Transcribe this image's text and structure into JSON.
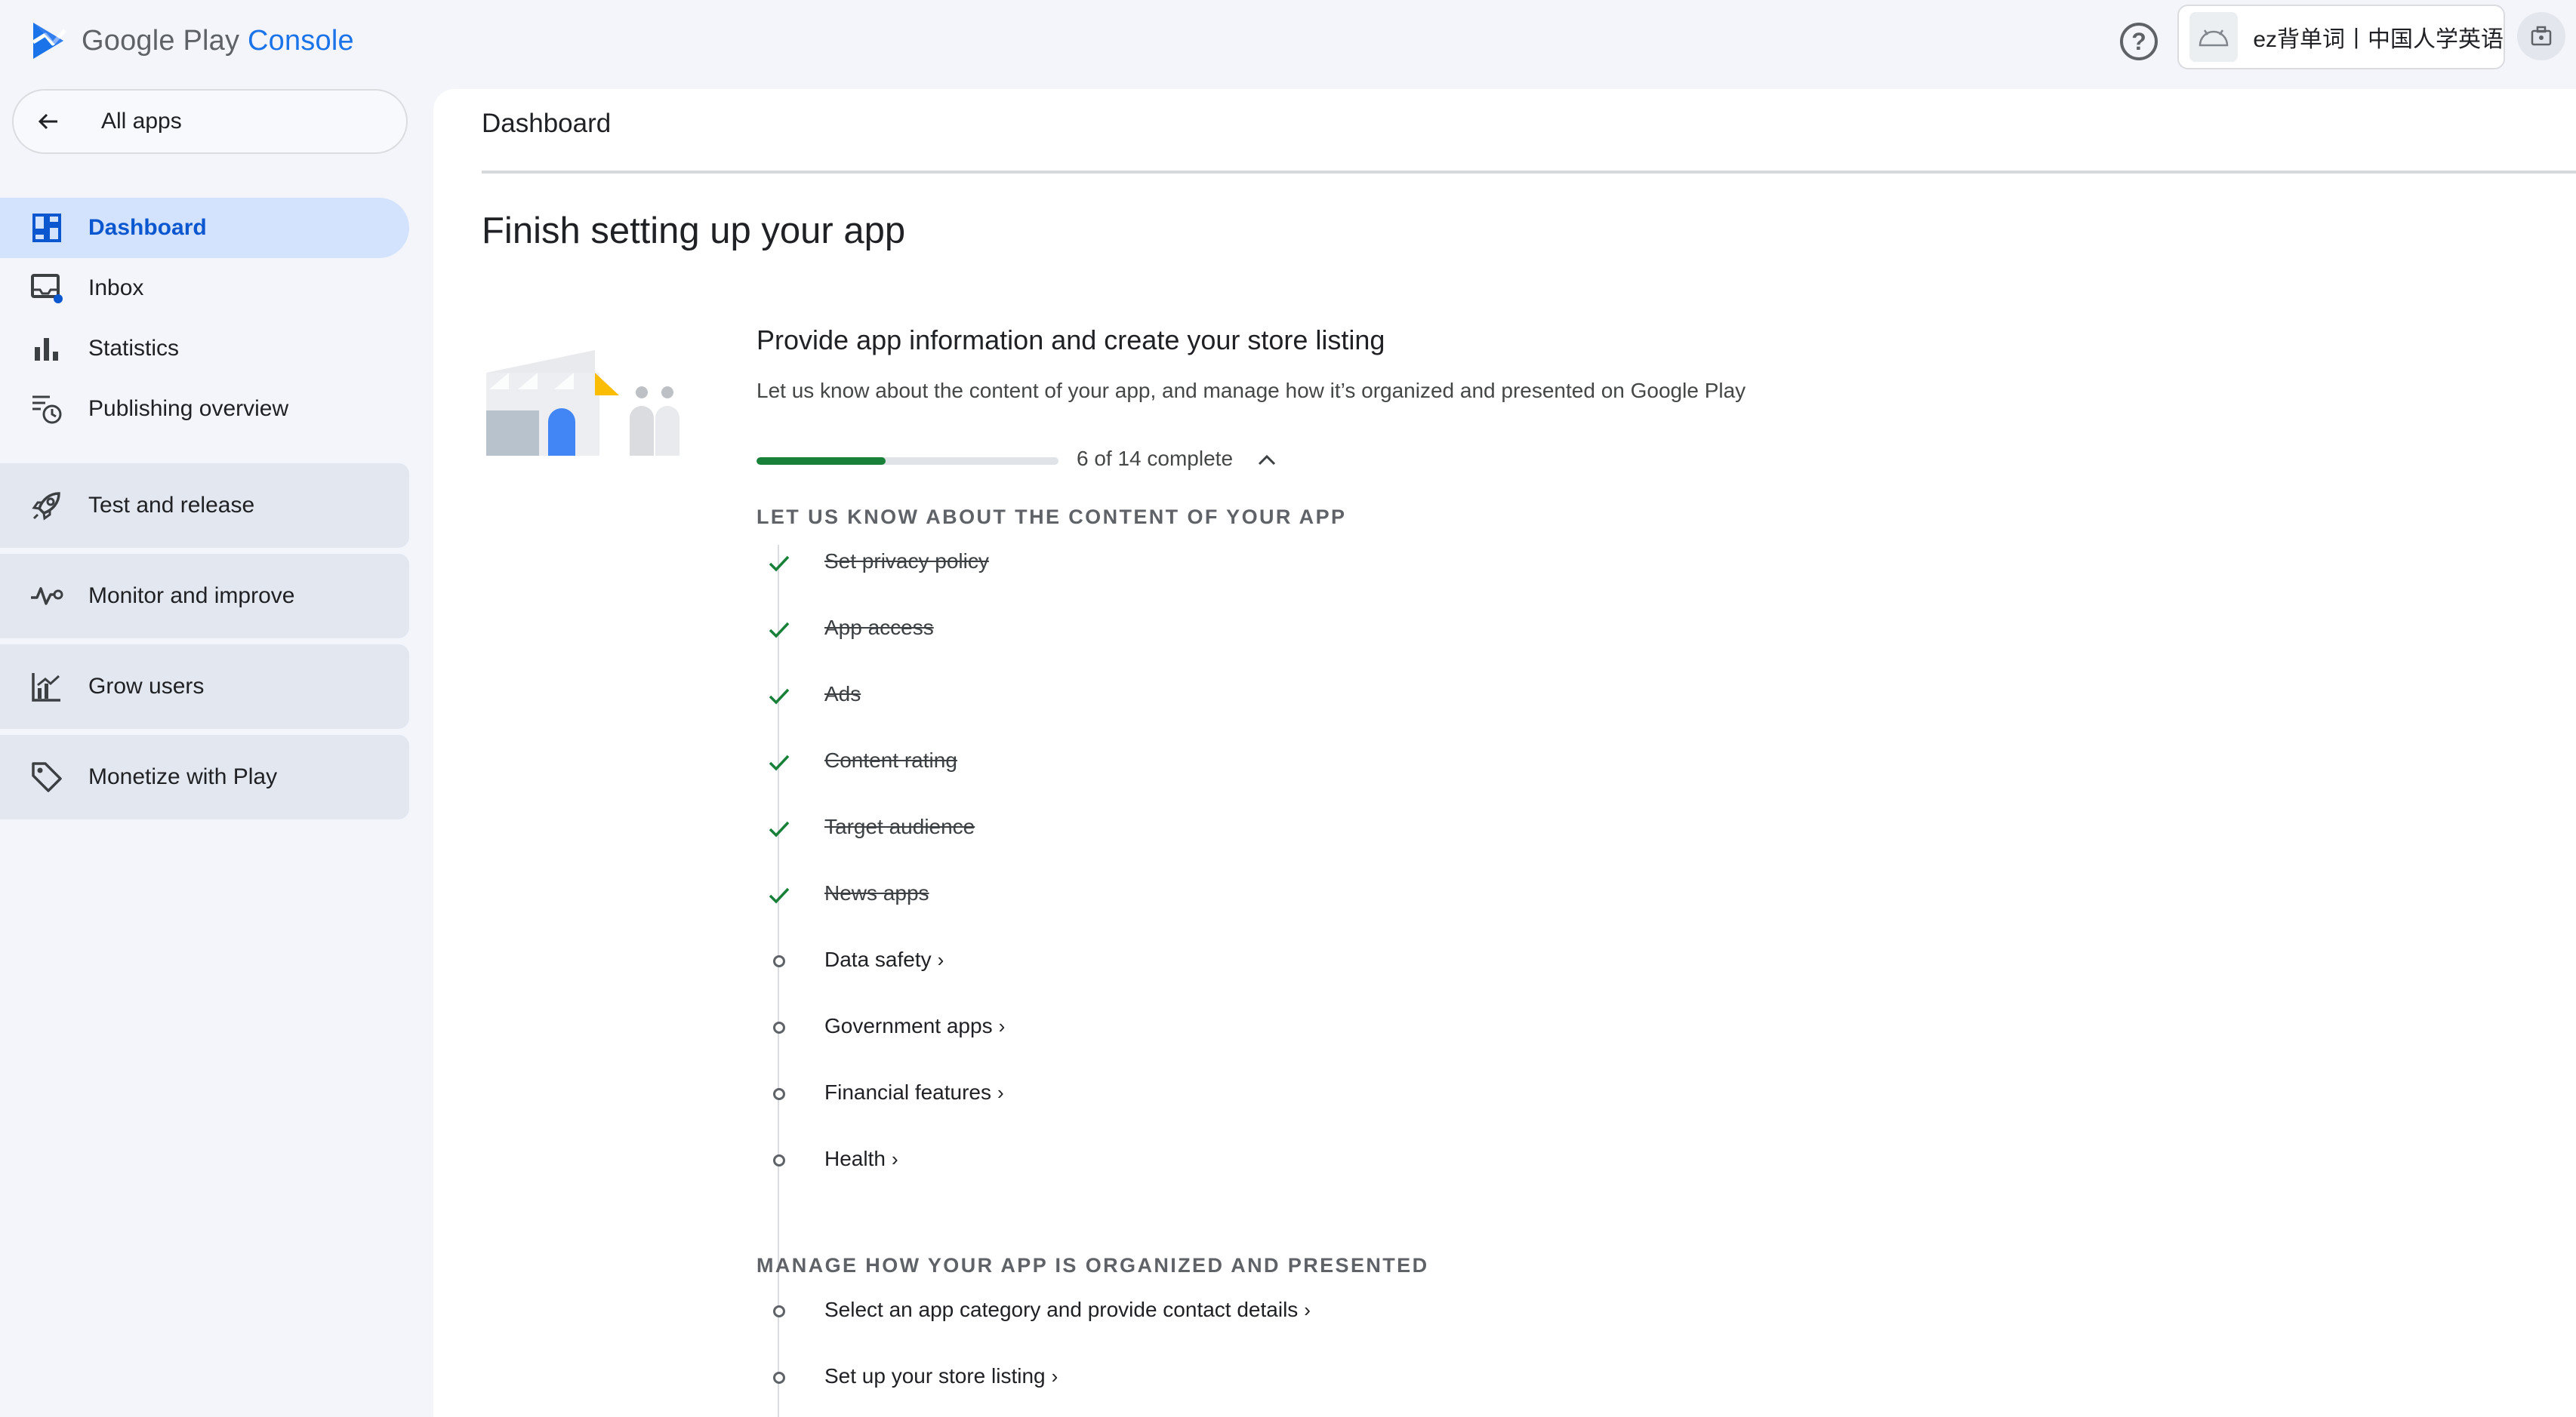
{
  "app": {
    "brand_google_play": "Google Play",
    "brand_console": "Console",
    "help_icon_label": "?",
    "app_name": "ez背单词丨中国人学英语"
  },
  "sidebar": {
    "all_apps": "All apps",
    "items": [
      {
        "label": "Dashboard",
        "icon": "dashboard-icon",
        "active": true
      },
      {
        "label": "Inbox",
        "icon": "inbox-icon",
        "active": false
      },
      {
        "label": "Statistics",
        "icon": "bar-chart-icon",
        "active": false
      },
      {
        "label": "Publishing overview",
        "icon": "publishing-clock-icon",
        "active": false
      }
    ],
    "groups": [
      {
        "label": "Test and release",
        "icon": "rocket-icon"
      },
      {
        "label": "Monitor and improve",
        "icon": "vitals-icon"
      },
      {
        "label": "Grow users",
        "icon": "growth-icon"
      },
      {
        "label": "Monetize with Play",
        "icon": "tag-icon"
      }
    ]
  },
  "main": {
    "page_title": "Dashboard",
    "heading": "Finish setting up your app",
    "section": {
      "title": "Provide app information and create your store listing",
      "description": "Let us know about the content of your app, and manage how it’s organized and presented on Google Play",
      "progress_label": "6 of 14 complete",
      "progress_fraction": 0.4286,
      "group1_label": "LET US KNOW ABOUT THE CONTENT OF YOUR APP",
      "group1_tasks": [
        {
          "label": "Set privacy policy",
          "done": true
        },
        {
          "label": "App access",
          "done": true
        },
        {
          "label": "Ads",
          "done": true
        },
        {
          "label": "Content rating",
          "done": true
        },
        {
          "label": "Target audience",
          "done": true
        },
        {
          "label": "News apps",
          "done": true
        },
        {
          "label": "Data safety",
          "done": false
        },
        {
          "label": "Government apps",
          "done": false
        },
        {
          "label": "Financial features",
          "done": false
        },
        {
          "label": "Health",
          "done": false
        }
      ],
      "group2_label": "MANAGE HOW YOUR APP IS ORGANIZED AND PRESENTED",
      "group2_tasks": [
        {
          "label": "Select an app category and provide contact details",
          "done": false
        },
        {
          "label": "Set up your store listing",
          "done": false
        }
      ]
    }
  },
  "colors": {
    "accent": "#0b57d0",
    "active_bg": "#d3e3fd",
    "progress_fill": "#188038",
    "check_green": "#188038",
    "sidebar_bg": "#f3f5fb",
    "group_bg": "#e3e7ef"
  }
}
